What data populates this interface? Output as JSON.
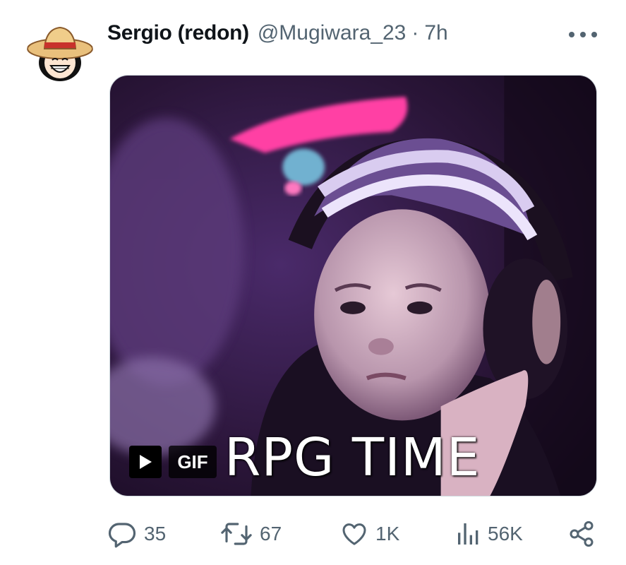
{
  "tweet": {
    "display_name": "Sergio (redon)",
    "handle": "@Mugiwara_23",
    "separator": "·",
    "time": "7h",
    "more_icon": "more-horizontal-icon",
    "avatar_icon": "straw-hat-avatar"
  },
  "media": {
    "type": "gif",
    "badge_label": "GIF",
    "caption": "RPG TIME",
    "play_icon": "play-icon"
  },
  "actions": {
    "replies": "35",
    "retweets": "67",
    "likes": "1K",
    "views": "56K",
    "reply_icon": "reply-icon",
    "retweet_icon": "retweet-icon",
    "like_icon": "heart-icon",
    "views_icon": "views-icon",
    "share_icon": "share-icon"
  },
  "colors": {
    "text_primary": "#0f1419",
    "text_secondary": "#536471",
    "border": "#cfd9de"
  }
}
